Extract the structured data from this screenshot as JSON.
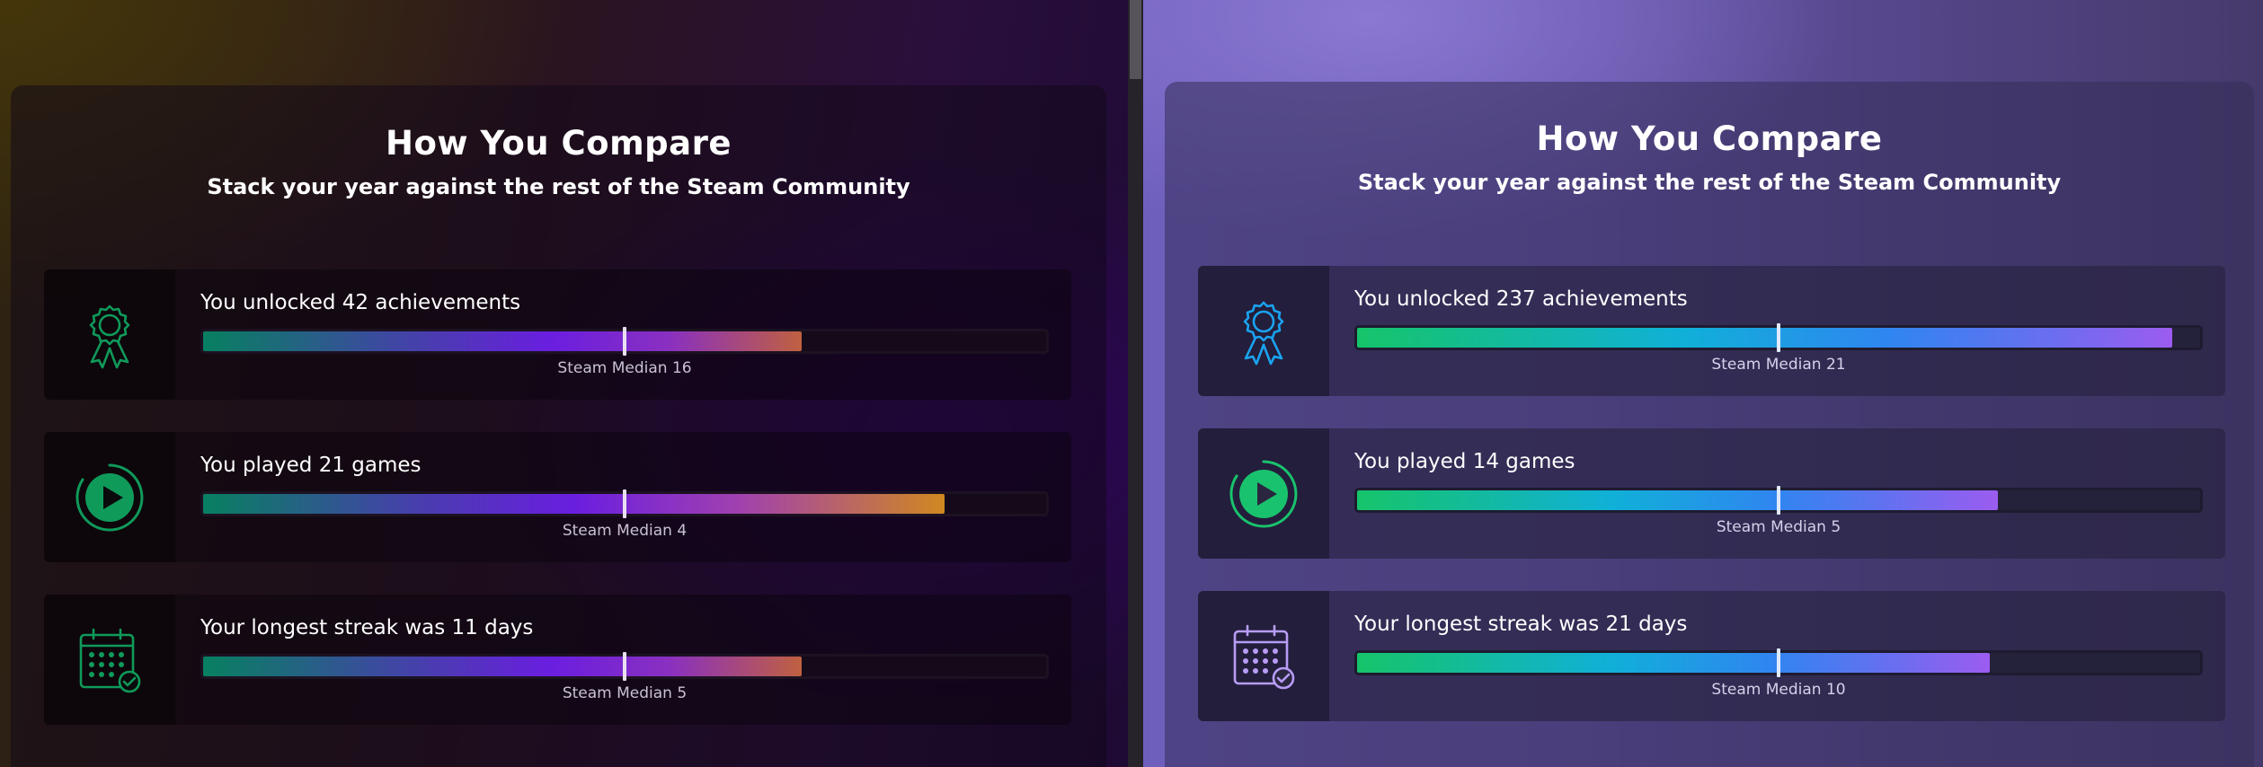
{
  "left": {
    "title": "How You Compare",
    "subtitle": "Stack your year against the rest of the Steam Community",
    "stats": [
      {
        "label": "You unlocked 42 achievements",
        "median_label": "Steam Median 16",
        "fill_fraction": 0.71,
        "median_fraction": 0.5,
        "icon": "ribbon-award-icon"
      },
      {
        "label": "You played 21 games",
        "median_label": "Steam Median 4",
        "fill_fraction": 0.88,
        "median_fraction": 0.5,
        "icon": "play-circle-icon"
      },
      {
        "label": "Your longest streak was 11 days",
        "median_label": "Steam Median 5",
        "fill_fraction": 0.71,
        "median_fraction": 0.5,
        "icon": "calendar-check-icon"
      }
    ],
    "icon_color": "#0f9a5a"
  },
  "right": {
    "title": "How You Compare",
    "subtitle": "Stack your year against the rest of the Steam Community",
    "stats": [
      {
        "label": "You unlocked 237 achievements",
        "median_label": "Steam Median 21",
        "fill_fraction": 0.967,
        "median_fraction": 0.5,
        "icon": "ribbon-award-icon"
      },
      {
        "label": "You played 14 games",
        "median_label": "Steam Median 5",
        "fill_fraction": 0.76,
        "median_fraction": 0.5,
        "icon": "play-circle-icon"
      },
      {
        "label": "Your longest streak was 21 days",
        "median_label": "Steam Median 10",
        "fill_fraction": 0.75,
        "median_fraction": 0.5,
        "icon": "calendar-check-icon"
      }
    ],
    "icon_colors": {
      "ribbon": "#1aa3f0",
      "play": "#19c26c",
      "calendar": "#b79cf6"
    }
  }
}
